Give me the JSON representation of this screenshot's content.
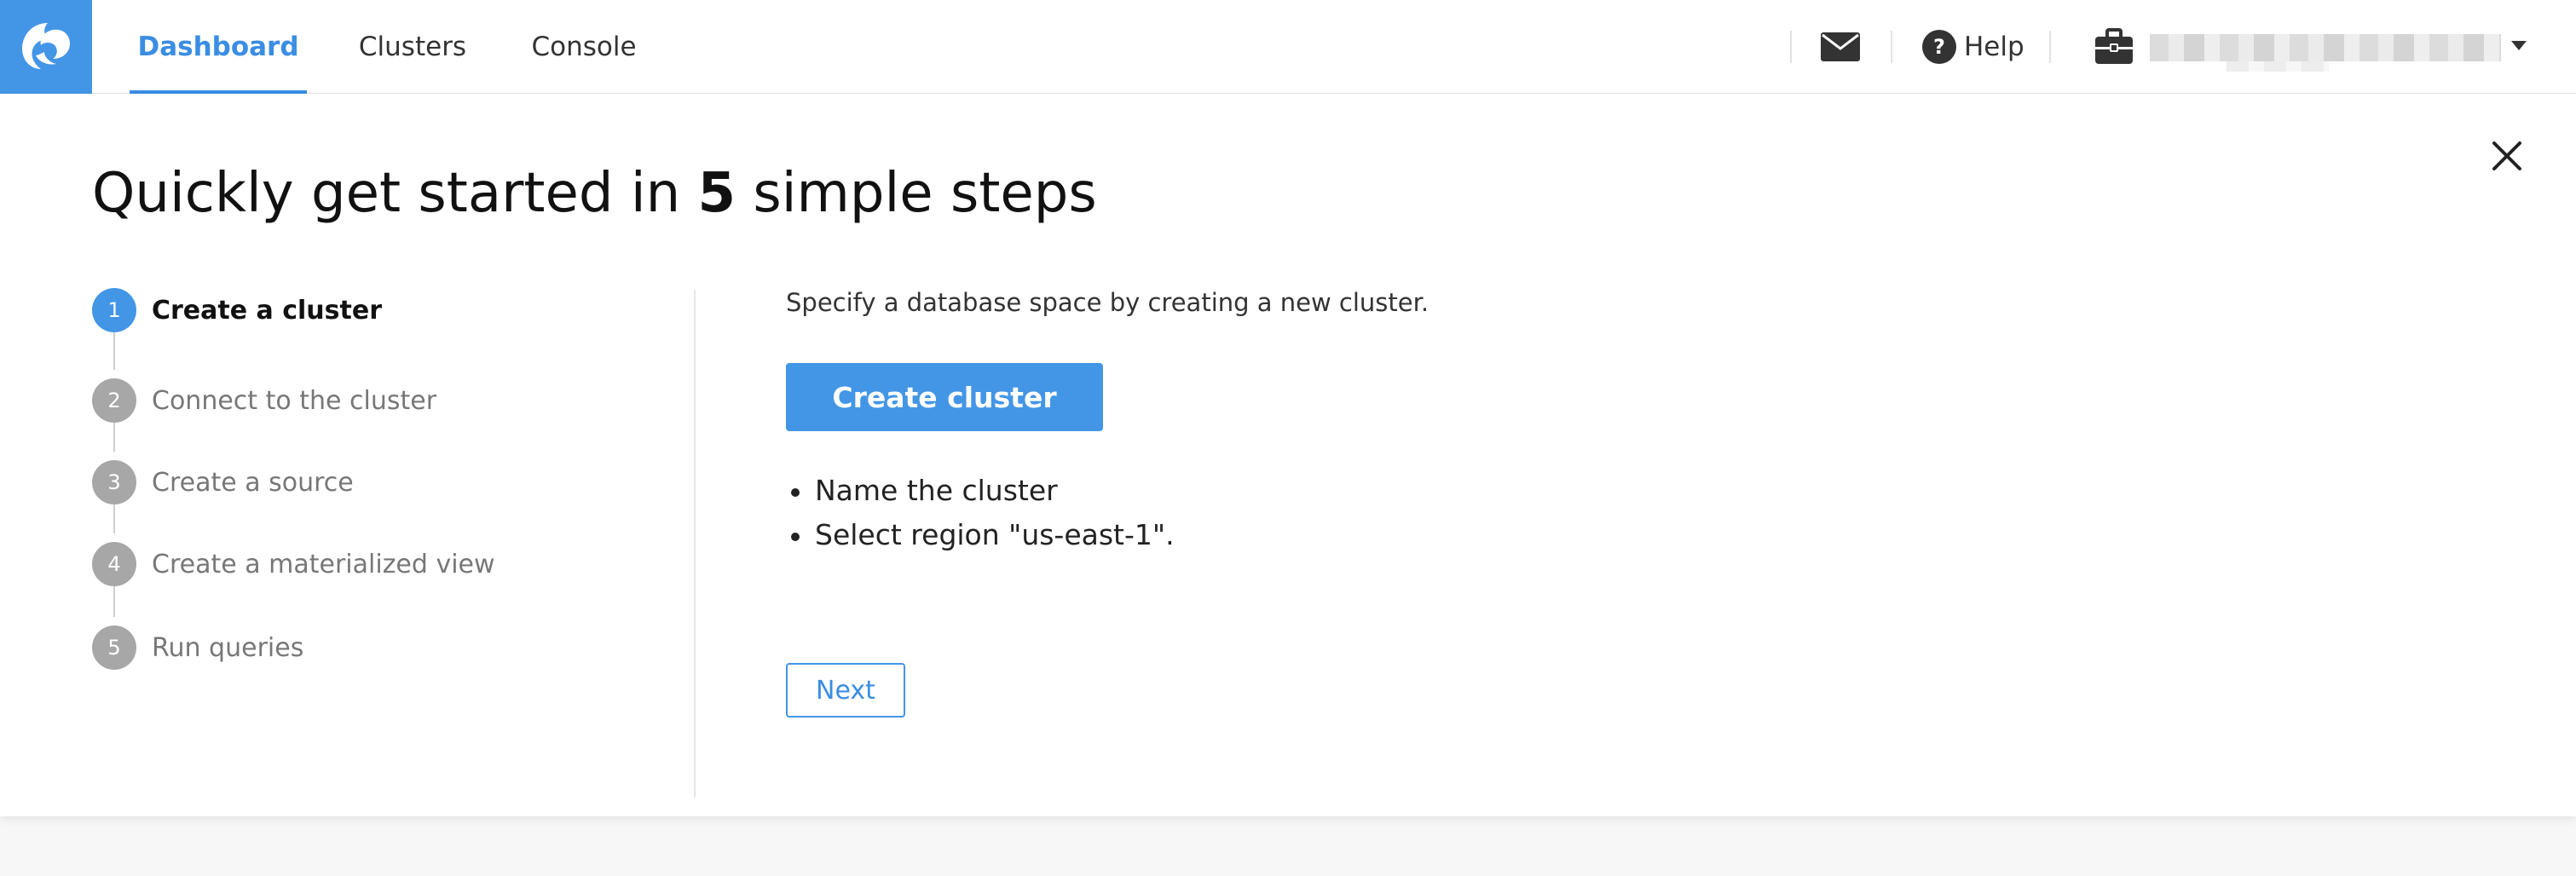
{
  "nav": {
    "tabs": [
      {
        "label": "Dashboard",
        "active": true
      },
      {
        "label": "Clusters",
        "active": false
      },
      {
        "label": "Console",
        "active": false
      }
    ],
    "help_label": "Help"
  },
  "colors": {
    "accent": "#4396e6",
    "inactive_step": "#a7a7a7"
  },
  "icons": {
    "logo": "wave-logo-icon",
    "mail": "envelope-icon",
    "help": "question-circle-icon",
    "account": "briefcase-icon",
    "menu": "caret-down-icon",
    "close": "close-icon"
  },
  "onboarding": {
    "title_prefix": "Quickly get started in ",
    "title_count": "5",
    "title_suffix": " simple steps",
    "steps": [
      {
        "number": "1",
        "label": "Create a cluster",
        "active": true
      },
      {
        "number": "2",
        "label": "Connect to the cluster",
        "active": false
      },
      {
        "number": "3",
        "label": "Create a source",
        "active": false
      },
      {
        "number": "4",
        "label": "Create a materialized view",
        "active": false
      },
      {
        "number": "5",
        "label": "Run queries",
        "active": false
      }
    ],
    "description": "Specify a database space by creating a new cluster.",
    "primary_button": "Create cluster",
    "instructions": [
      "Name the cluster",
      "Select region \"us-east-1\"."
    ],
    "next_button": "Next"
  }
}
